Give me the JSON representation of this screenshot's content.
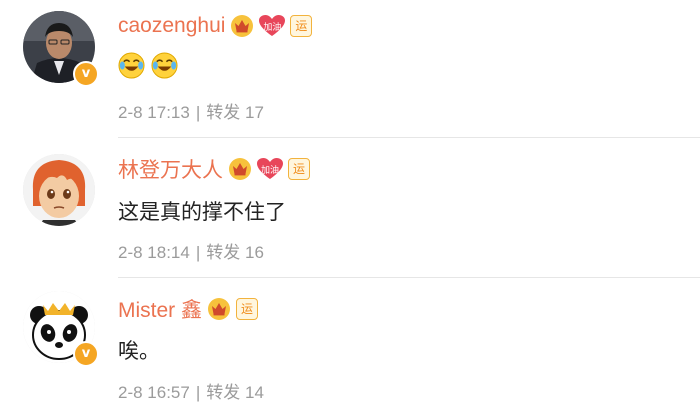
{
  "colors": {
    "username": "#eb7350",
    "vip_badge": "#f5a623",
    "meta": "#9b9b9b"
  },
  "badges": {
    "jiayou_text": "加油",
    "yun_text": "运"
  },
  "comments": [
    {
      "username": "caozenghui",
      "content": "",
      "emojis": [
        "laugh-cry-emoji",
        "laugh-cry-emoji"
      ],
      "verified": true,
      "badges": [
        "crown",
        "jiayou",
        "yun"
      ],
      "date": "2-8 17:13",
      "repost_label": "转发",
      "repost_count": "17"
    },
    {
      "username": "林登万大人",
      "content": "这是真的撑不住了",
      "verified": false,
      "badges": [
        "crown",
        "jiayou",
        "yun"
      ],
      "date": "2-8 18:14",
      "repost_label": "转发",
      "repost_count": "16"
    },
    {
      "username": "Mister 鑫",
      "content": "唉。",
      "verified": true,
      "badges": [
        "crown",
        "yun"
      ],
      "date": "2-8 16:57",
      "repost_label": "转发",
      "repost_count": "14"
    }
  ]
}
